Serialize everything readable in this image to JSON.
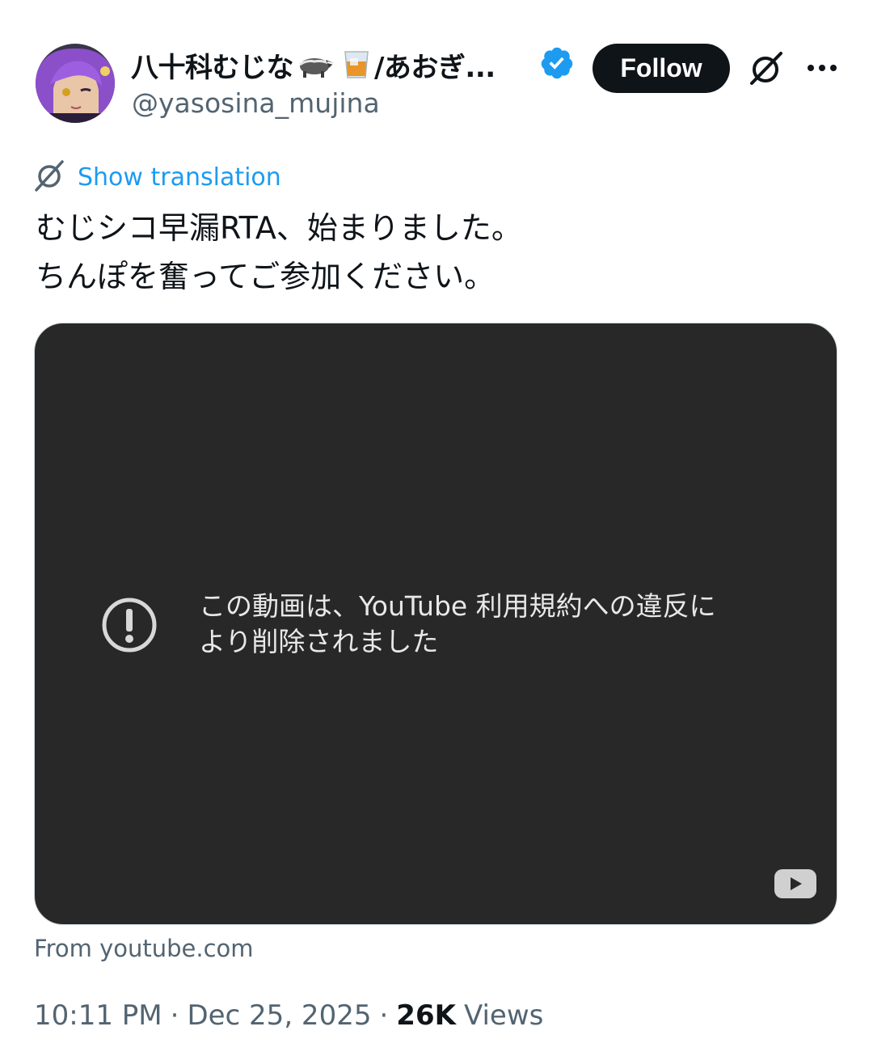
{
  "author": {
    "display_name": "八十科むじな",
    "display_name_suffix": "/あおぎ...",
    "emoji_1": "badger",
    "emoji_2": "tumbler-glass",
    "handle": "@yasosina_mujina",
    "verified": true,
    "verified_color": "#1d9bf0",
    "avatar_hair_color": "#8b4fc9"
  },
  "actions": {
    "follow_label": "Follow",
    "grok_icon": "grok-icon",
    "more_icon": "more-icon"
  },
  "translation": {
    "label": "Show translation",
    "color": "#1d9bf0"
  },
  "tweet": {
    "lines": [
      "むじシコ早漏RTA、始まりました。",
      "ちんぽを奮ってご参加ください。"
    ]
  },
  "media": {
    "message_line1": "この動画は、YouTube 利用規約への違反に",
    "message_line2": "より削除されました",
    "icon": "warning-icon",
    "logo": "youtube-logo",
    "background": "#282828"
  },
  "source_label": "From youtube.com",
  "meta": {
    "time": "10:11 PM",
    "separator": "·",
    "date": "Dec 25, 2025",
    "views_count": "26K",
    "views_label": "Views"
  }
}
